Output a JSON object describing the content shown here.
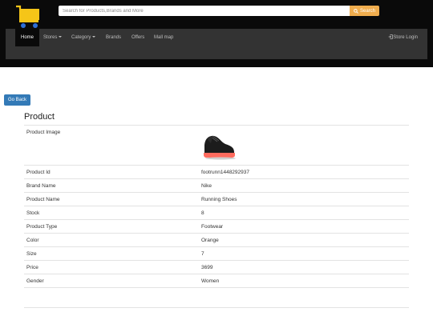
{
  "header": {
    "logo_icon": "shopping-cart-icon",
    "search": {
      "placeholder": "Search for Products,Brands and More",
      "button_label": "Search",
      "button_icon": "search-icon"
    },
    "nav": {
      "items": [
        {
          "label": "Home",
          "active": true
        },
        {
          "label": "Stores",
          "dropdown": true
        },
        {
          "label": "Category",
          "dropdown": true
        },
        {
          "label": "Brands"
        },
        {
          "label": "Offers"
        },
        {
          "label": "Mall map"
        }
      ],
      "store_login": {
        "label": "Store Login",
        "icon": "login-icon"
      }
    }
  },
  "go_back_label": "Go Back",
  "product": {
    "heading": "Product",
    "image_label": "Product Image",
    "image_icon": "sneaker-image",
    "rows": [
      {
        "label": "Product Id",
        "value": "footrunn1448292937"
      },
      {
        "label": "Brand Name",
        "value": "Nike"
      },
      {
        "label": "Product Name",
        "value": "Running Shoes"
      },
      {
        "label": "Stock",
        "value": "8"
      },
      {
        "label": "Product Type",
        "value": "Footwear"
      },
      {
        "label": "Color",
        "value": "Orange"
      },
      {
        "label": "Size",
        "value": "7"
      },
      {
        "label": "Price",
        "value": "3699"
      },
      {
        "label": "Gender",
        "value": "Women"
      }
    ]
  },
  "colors": {
    "topbar": "#0a0a0a",
    "navbar": "#333333",
    "search_button": "#f0ad4e",
    "primary_button": "#337ab7",
    "cart_yellow": "#f5c518",
    "cart_wheels": "#2f6fd6"
  }
}
